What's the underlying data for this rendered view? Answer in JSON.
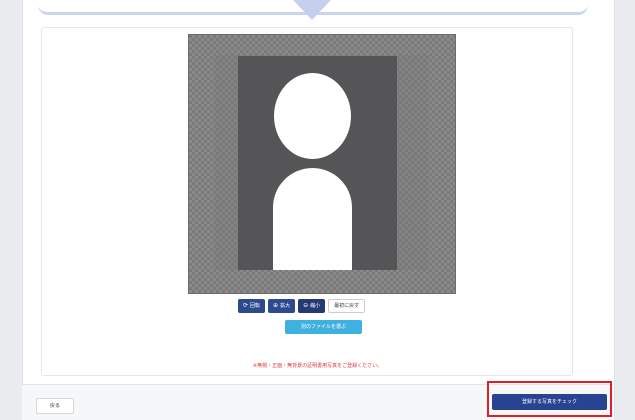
{
  "toolbar": {
    "rotate_label": "回転",
    "zoom_in_label": "拡大",
    "zoom_out_label": "縮小",
    "reset_label": "最初に戻す"
  },
  "reselect_label": "別のファイルを選ぶ",
  "notice_text": "※無帽・正面・無背景の証明書用写真をご登録ください。",
  "footer": {
    "back_label": "戻る",
    "check_label": "登録する写真をチェック"
  },
  "colors": {
    "primary": "#274391",
    "secondary": "#3fb1e0",
    "notice": "#e23a3a",
    "highlight": "#e01e27"
  }
}
